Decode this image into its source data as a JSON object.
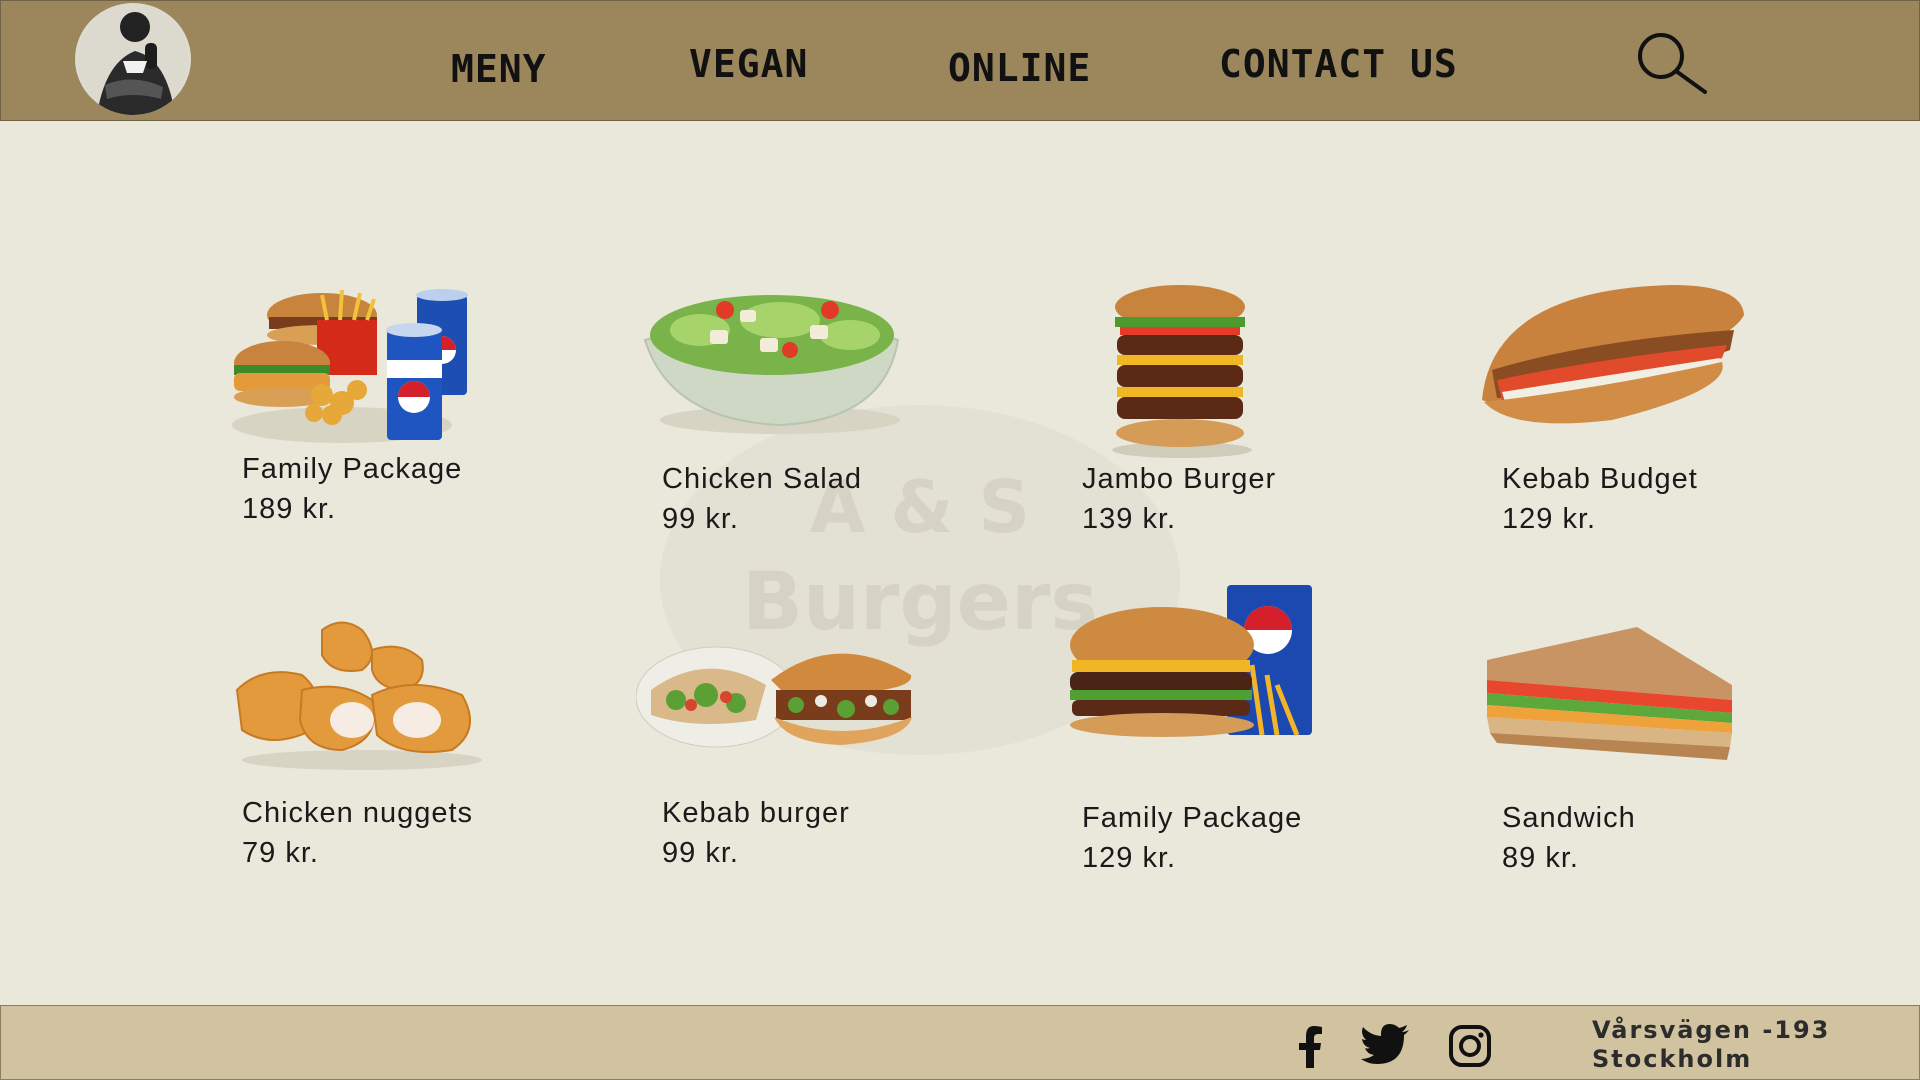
{
  "brand": {
    "watermark_line1": "A & S",
    "watermark_line2": "Burgers"
  },
  "nav": {
    "items": [
      {
        "label": "MENY"
      },
      {
        "label": "VEGAN"
      },
      {
        "label": "ONLINE"
      },
      {
        "label": "CONTACT US"
      }
    ],
    "search_icon": "search-icon"
  },
  "menu": {
    "items": [
      {
        "name": "Family Package",
        "price": "189 kr.",
        "icon": "family-package-image"
      },
      {
        "name": "Chicken Salad",
        "price": "99 kr.",
        "icon": "chicken-salad-image"
      },
      {
        "name": "Jambo Burger",
        "price": "139 kr.",
        "icon": "jambo-burger-image"
      },
      {
        "name": "Kebab Budget",
        "price": "129 kr.",
        "icon": "kebab-budget-image"
      },
      {
        "name": "Chicken nuggets",
        "price": "79 kr.",
        "icon": "chicken-nuggets-image"
      },
      {
        "name": "Kebab burger",
        "price": "99 kr.",
        "icon": "kebab-burger-image"
      },
      {
        "name": "Family Package",
        "price": "129 kr.",
        "icon": "family-package-image"
      },
      {
        "name": "Sandwich",
        "price": "89 kr.",
        "icon": "sandwich-image"
      }
    ]
  },
  "footer": {
    "social": [
      "facebook-icon",
      "twitter-icon",
      "instagram-icon"
    ],
    "address_line1": "Vårsvägen -193",
    "address_line2": "Stockholm"
  },
  "colors": {
    "header_bg": "#9c875c",
    "page_bg": "#e9e8da",
    "footer_bg": "#d1c3a0",
    "text": "#1a1a1a"
  }
}
